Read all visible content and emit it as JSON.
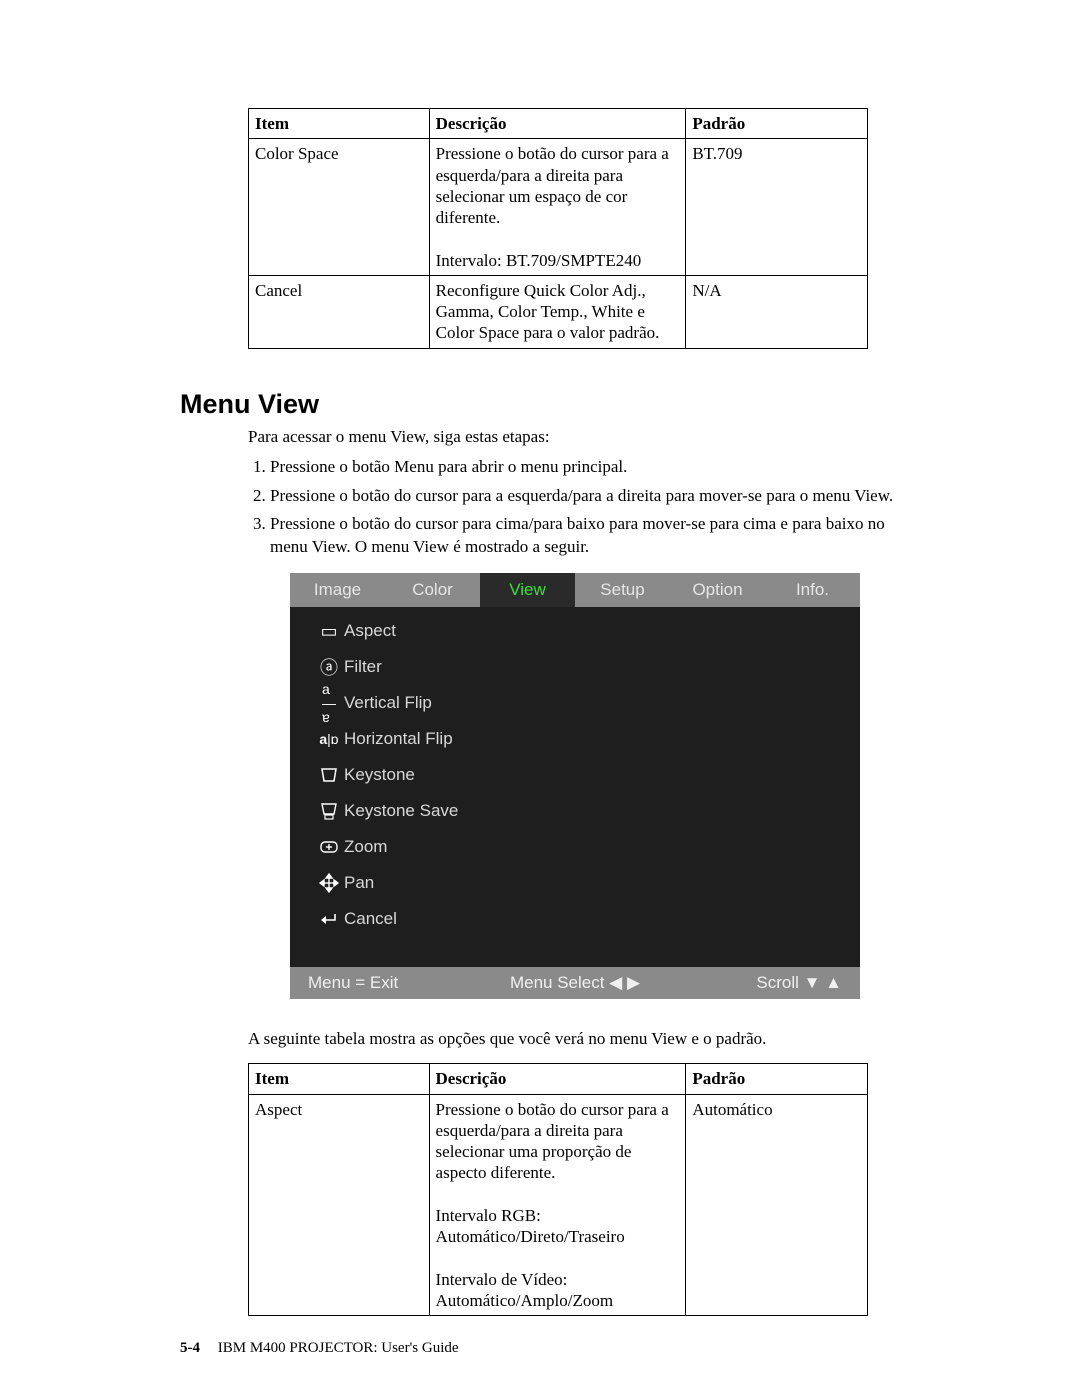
{
  "top_table": {
    "headers": {
      "item": "Item",
      "desc": "Descrição",
      "def": "Padrão"
    },
    "rows": [
      {
        "item": "Color Space",
        "desc": "Pressione o botão do cursor para a esquerda/para a direita para selecionar um espaço de cor diferente.\n\nIntervalo: BT.709/SMPTE240",
        "def": "BT.709"
      },
      {
        "item": "Cancel",
        "desc": "Reconfigure Quick Color Adj., Gamma, Color Temp., White e Color Space para o valor padrão.",
        "def": "N/A"
      }
    ]
  },
  "heading": "Menu View",
  "intro": "Para acessar o menu View, siga estas etapas:",
  "steps": [
    "Pressione o botão Menu para abrir o menu principal.",
    "Pressione o botão do cursor para a esquerda/para a direita para mover-se para o menu View.",
    "Pressione o botão do cursor para cima/para baixo para mover-se para cima e para baixo no menu View. O menu View é mostrado a seguir."
  ],
  "osd": {
    "tabs": [
      "Image",
      "Color",
      "View",
      "Setup",
      "Option",
      "Info."
    ],
    "active_tab": "View",
    "items": [
      "Aspect",
      "Filter",
      "Vertical Flip",
      "Horizontal Flip",
      "Keystone",
      "Keystone Save",
      "Zoom",
      "Pan",
      "Cancel"
    ],
    "footer": {
      "left": "Menu = Exit",
      "center": "Menu Select ◀ ▶",
      "right": "Scroll ▼ ▲"
    }
  },
  "below": "A seguinte tabela mostra as opções que você verá no menu View e o padrão.",
  "bottom_table": {
    "headers": {
      "item": "Item",
      "desc": "Descrição",
      "def": "Padrão"
    },
    "rows": [
      {
        "item": "Aspect",
        "desc": "Pressione o botão do cursor para a esquerda/para a direita para selecionar uma proporção de aspecto diferente.\n\nIntervalo RGB: Automático/Direto/Traseiro\n\nIntervalo de Vídeo: Automático/Amplo/Zoom",
        "def": "Automático"
      }
    ]
  },
  "footer": {
    "num": "5-4",
    "text": "IBM M400 PROJECTOR: User's Guide"
  }
}
